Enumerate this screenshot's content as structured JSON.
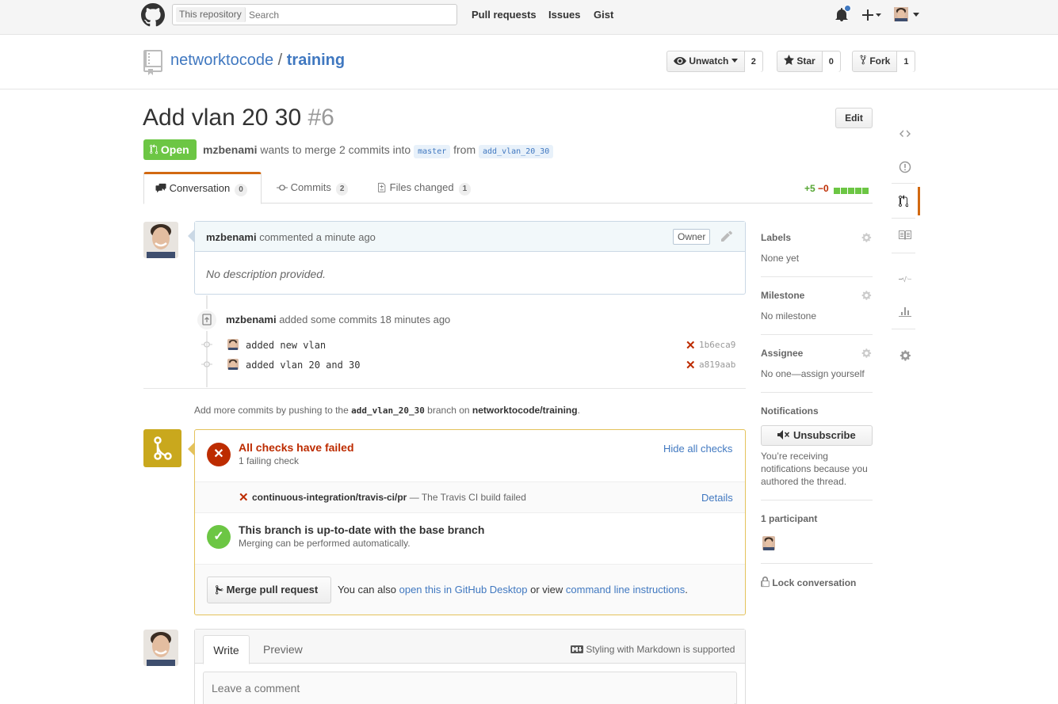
{
  "header": {
    "search_scope": "This repository",
    "search_placeholder": "Search",
    "nav": [
      "Pull requests",
      "Issues",
      "Gist"
    ],
    "icons": [
      "github-logo",
      "bell-icon",
      "plus-icon",
      "avatar"
    ]
  },
  "repo": {
    "owner": "networktocode",
    "separator": "/",
    "name": "training",
    "watch_label": "Unwatch",
    "watch_count": "2",
    "star_label": "Star",
    "star_count": "0",
    "fork_label": "Fork",
    "fork_count": "1"
  },
  "pr": {
    "title": "Add vlan 20 30",
    "number": "#6",
    "edit_label": "Edit",
    "state": "Open",
    "author": "mzbenami",
    "meta_mid": "wants to merge 2 commits into",
    "base_branch": "master",
    "meta_from": "from",
    "head_branch": "add_vlan_20_30"
  },
  "tabs": [
    {
      "label": "Conversation",
      "count": "0"
    },
    {
      "label": "Commits",
      "count": "2"
    },
    {
      "label": "Files changed",
      "count": "1"
    }
  ],
  "diffstat": {
    "additions": "+5",
    "deletions": "−0"
  },
  "comment": {
    "author": "mzbenami",
    "action": "commented",
    "time": "a minute ago",
    "role": "Owner",
    "body": "No description provided."
  },
  "push": {
    "author": "mzbenami",
    "action": "added some commits",
    "time": "18 minutes ago",
    "commits": [
      {
        "message": "added new vlan",
        "sha": "1b6eca9"
      },
      {
        "message": "added vlan 20 and 30",
        "sha": "a819aab"
      }
    ]
  },
  "more_commits": {
    "prefix": "Add more commits by pushing to the",
    "branch": "add_vlan_20_30",
    "middle": "branch on",
    "repo": "networktocode/training",
    "suffix": "."
  },
  "merge": {
    "checks_title": "All checks have failed",
    "checks_sub": "1 failing check",
    "hide_label": "Hide all checks",
    "check_name": "continuous-integration/travis-ci/pr",
    "check_desc": "— The Travis CI build failed",
    "details_label": "Details",
    "uptodate_title": "This branch is up-to-date with the base branch",
    "uptodate_sub": "Merging can be performed automatically.",
    "merge_button": "Merge pull request",
    "also_text": "You can also",
    "desktop_link": "open this in GitHub Desktop",
    "or_view": "or view",
    "cli_link": "command line instructions",
    "end": "."
  },
  "form": {
    "write_tab": "Write",
    "preview_tab": "Preview",
    "markdown_note": "Styling with Markdown is supported",
    "placeholder": "Leave a comment"
  },
  "sidebar": {
    "labels_h": "Labels",
    "labels_v": "None yet",
    "milestone_h": "Milestone",
    "milestone_v": "No milestone",
    "assignee_h": "Assignee",
    "assignee_v": "No one—assign yourself",
    "notifications_h": "Notifications",
    "unsubscribe": "Unsubscribe",
    "notify_reason": "You’re receiving notifications because you authored the thread.",
    "participants_h": "1 participant",
    "lock": "Lock conversation"
  },
  "colors": {
    "link": "#4078c0",
    "open_green": "#6cc644",
    "fail_red": "#bd2c00",
    "accent_orange": "#d26911",
    "merge_yellow": "#c9a81d"
  }
}
